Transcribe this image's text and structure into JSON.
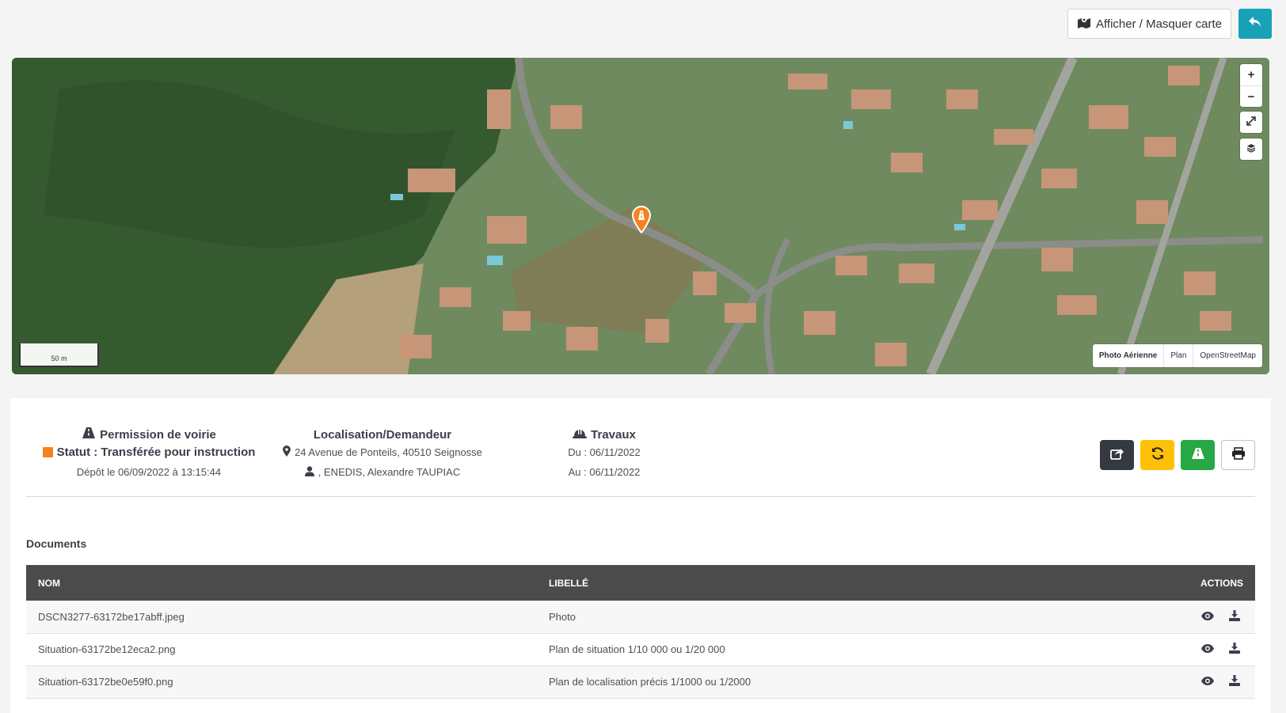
{
  "toolbar": {
    "toggle_map_label": "Afficher / Masquer carte",
    "toggle_map_icon": "map-marked-icon",
    "back_icon": "reply-icon",
    "back_color": "#17a2b8"
  },
  "map": {
    "zoom_in": "+",
    "zoom_out": "−",
    "scale_label": "50 m",
    "layers": [
      {
        "label": "Photo Aérienne",
        "active": true
      },
      {
        "label": "Plan",
        "active": false
      },
      {
        "label": "OpenStreetMap",
        "active": false
      }
    ],
    "marker_color": "#f58220"
  },
  "summary": {
    "permission": {
      "title": "Permission de voirie",
      "icon": "road-icon",
      "status_label": "Statut : Transférée pour instruction",
      "status_color": "#f58220",
      "deposit": "Dépôt le 06/09/2022 à 13:15:44"
    },
    "location": {
      "title": "Localisation/Demandeur",
      "address": "24 Avenue de Ponteils, 40510 Seignosse",
      "requester": ", ENEDIS, Alexandre TAUPIAC"
    },
    "works": {
      "title": "Travaux",
      "icon": "hard-hat-icon",
      "from": "Du : 06/11/2022",
      "to": "Au : 06/11/2022"
    },
    "actions": [
      {
        "name": "share-button",
        "icon": "share-icon",
        "color": "#343a40"
      },
      {
        "name": "refresh-button",
        "icon": "sync-icon",
        "color": "#ffc107"
      },
      {
        "name": "road-button",
        "icon": "road-icon",
        "color": "#28a745"
      },
      {
        "name": "print-button",
        "icon": "print-icon",
        "color": "#ffffff"
      }
    ]
  },
  "documents": {
    "title": "Documents",
    "columns": {
      "name": "NOM",
      "label": "LIBELLÉ",
      "actions": "ACTIONS"
    },
    "rows": [
      {
        "name": "DSCN3277-63172be17abff.jpeg",
        "label": "Photo"
      },
      {
        "name": "Situation-63172be12eca2.png",
        "label": "Plan de situation 1/10 000 ou 1/20 000"
      },
      {
        "name": "Situation-63172be0e59f0.png",
        "label": "Plan de localisation précis 1/1000 ou 1/2000"
      }
    ]
  }
}
